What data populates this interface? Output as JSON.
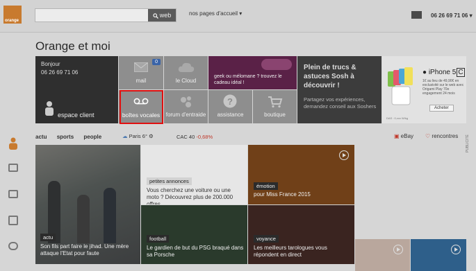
{
  "header": {
    "logo_text": "orange",
    "search": {
      "placeholder": "",
      "button_label": "web"
    },
    "pages_accueil": "nos pages d'accueil",
    "phone": "06 26 69 71 06"
  },
  "page_title": "Orange et moi",
  "tiles": {
    "espace": {
      "greeting": "Bonjour",
      "number": "06 26 69 71 06",
      "label": "espace client"
    },
    "mail": {
      "label": "mail",
      "badge": "0"
    },
    "cloud": {
      "label": "le Cloud"
    },
    "promo": {
      "text": "geek ou mélomane ? trouvez le cadeau idéal !"
    },
    "boites": {
      "label": "boîtes vocales"
    },
    "forum": {
      "label": "forum d'entraide"
    },
    "assistance": {
      "label": "assistance"
    },
    "boutique": {
      "label": "boutique"
    },
    "sosh": {
      "headline": "Plein de trucs & astuces Sosh à découvrir !",
      "sub": "Partagez vos expériences, demandez conseil aux Soshers"
    }
  },
  "ad_iphone": {
    "brand": "iPhone 5",
    "brand_suffix": "C",
    "desc": "1€ au lieu de 49,90€ en exclusivité sur le web avec Origami Play 70e engagement 24 mois",
    "cta": "Acheter",
    "fine": "DAS : 0,xxx W/kg"
  },
  "nav": {
    "items": [
      "actu",
      "sports",
      "people"
    ]
  },
  "weather": {
    "city": "Paris",
    "temp": "6°"
  },
  "cac": {
    "label": "CAC 40",
    "value": "-0,68%"
  },
  "partners": {
    "ebay": "eBay",
    "rencontres": "rencontres"
  },
  "publicite": "PUBLICITÉ",
  "news": {
    "main": {
      "tag": "actu",
      "caption": "Son fils part faire le jihad. Une mère attaque l'Etat pour faute"
    },
    "annonces": {
      "tag": "petites annonces",
      "caption": "Vous cherchez une voiture ou une moto ? Découvrez plus de 200.000 offres"
    },
    "emotion": {
      "tag": "émotion",
      "caption": "pour Miss France 2015"
    },
    "football": {
      "tag": "football",
      "caption": "Le gardien de but du PSG braqué dans sa Porsche"
    },
    "voyance": {
      "tag": "voyance",
      "caption": "Les meilleurs tarologues vous répondent en direct"
    }
  },
  "colors": {
    "highlight": "#e01010",
    "accent": "#ff7900",
    "badge": "#3a64a8",
    "negative": "#c0392b"
  }
}
